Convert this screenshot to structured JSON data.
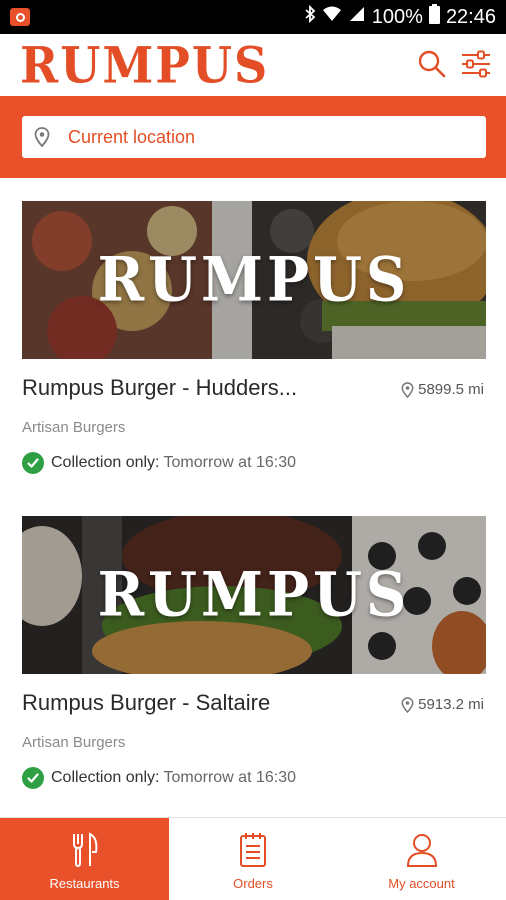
{
  "status_bar": {
    "battery": "100%",
    "time": "22:46"
  },
  "header": {
    "logo_text": "RUMPUS",
    "brand_color": "#e8512a"
  },
  "location": {
    "placeholder": "Current location"
  },
  "restaurants": [
    {
      "image_logo": "RUMPUS",
      "name": "Rumpus Burger - Hudders...",
      "distance": "5899.5 mi",
      "category": "Artisan Burgers",
      "collection_label": "Collection only:",
      "collection_time": "Tomorrow at 16:30"
    },
    {
      "image_logo": "RUMPUS",
      "name": "Rumpus Burger - Saltaire",
      "distance": "5913.2 mi",
      "category": "Artisan Burgers",
      "collection_label": "Collection only:",
      "collection_time": "Tomorrow at 16:30"
    }
  ],
  "bottom_nav": {
    "items": [
      {
        "label": "Restaurants",
        "icon": "cutlery-icon",
        "active": true
      },
      {
        "label": "Orders",
        "icon": "clipboard-icon",
        "active": false
      },
      {
        "label": "My account",
        "icon": "user-icon",
        "active": false
      }
    ]
  },
  "colors": {
    "accent": "#e8512a",
    "success": "#2ea043"
  }
}
